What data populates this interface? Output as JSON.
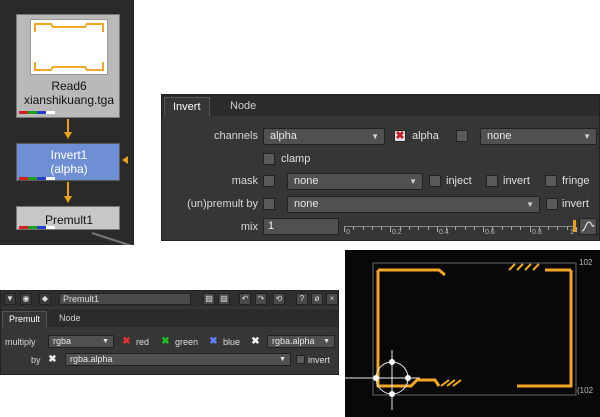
{
  "nodegraph": {
    "read_node": {
      "line1": "Read6",
      "line2": "xianshikuang.tga"
    },
    "invert_node": {
      "line1": "Invert1",
      "line2": "(alpha)"
    },
    "premult_node": {
      "label": "Premult1"
    },
    "colors": {
      "pipe": "#e5a21a",
      "invert_fill": "#6f8fd4",
      "read_fill": "#b9b9b9",
      "frame": "#f2a626"
    }
  },
  "invert_panel": {
    "tabs": [
      "Invert",
      "Node"
    ],
    "channels_label": "channels",
    "channels_value": "alpha",
    "alpha_label": "alpha",
    "channels_extra": "none",
    "clamp_label": "clamp",
    "mask_label": "mask",
    "mask_value": "none",
    "inject_label": "inject",
    "invert_label": "invert",
    "fringe_label": "fringe",
    "unpremult_label": "(un)premult by",
    "unpremult_value": "none",
    "unpremult_invert_label": "invert",
    "mix_label": "mix",
    "mix_value": "1",
    "mix_ticks": [
      "0",
      "0.2",
      "0.4",
      "0.6",
      "0.8",
      "1"
    ]
  },
  "premult_panel": {
    "node_name": "Premult1",
    "toolbar_icons": [
      "?",
      "ø",
      "×"
    ],
    "tabs": [
      "Premult",
      "Node"
    ],
    "multiply_label": "multiply",
    "multiply_value": "rgba",
    "red_label": "red",
    "green_label": "green",
    "blue_label": "blue",
    "alpha_value": "rgba.alpha",
    "by_label": "by",
    "by_value": "rgba.alpha",
    "invert_label": "invert"
  },
  "viewer": {
    "top_right_label": "102",
    "bottom_right_label": "(102"
  }
}
